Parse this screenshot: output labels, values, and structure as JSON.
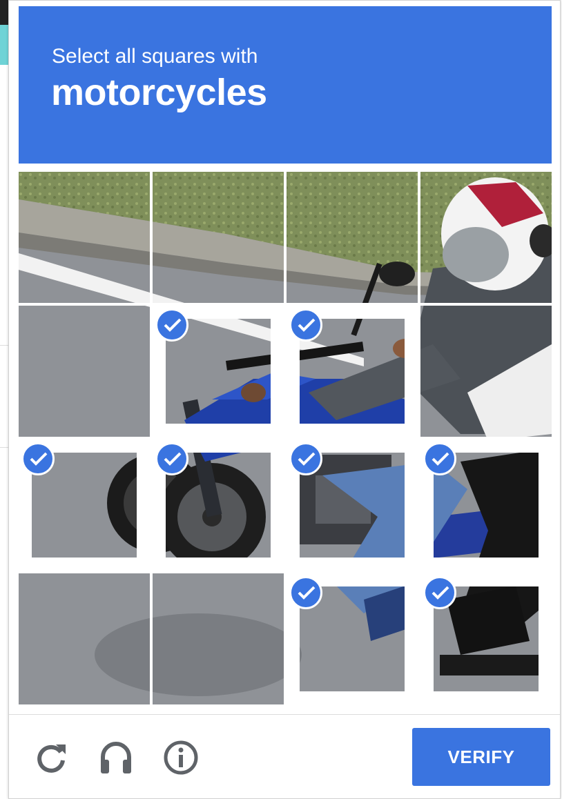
{
  "challenge": {
    "instruction": "Select all squares with",
    "target": "motorcycles"
  },
  "grid": {
    "rows": 4,
    "cols": 4,
    "tiles": [
      {
        "selected": false
      },
      {
        "selected": false
      },
      {
        "selected": false
      },
      {
        "selected": false
      },
      {
        "selected": false
      },
      {
        "selected": true
      },
      {
        "selected": true
      },
      {
        "selected": false
      },
      {
        "selected": true
      },
      {
        "selected": true
      },
      {
        "selected": true
      },
      {
        "selected": true
      },
      {
        "selected": false
      },
      {
        "selected": false
      },
      {
        "selected": true
      },
      {
        "selected": true
      }
    ]
  },
  "footer": {
    "reload_icon": "reload-icon",
    "audio_icon": "headphones-icon",
    "info_icon": "info-icon",
    "verify_label": "VERIFY"
  },
  "colors": {
    "accent": "#3a74e0"
  }
}
